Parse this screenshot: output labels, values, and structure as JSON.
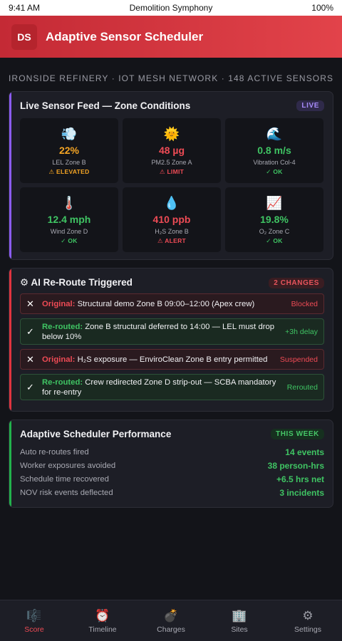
{
  "status_bar": {
    "time": "9:41 AM",
    "title": "Demolition Symphony",
    "battery": "100%"
  },
  "header": {
    "logo": "DS",
    "title": "Adaptive Sensor Scheduler"
  },
  "subtitle": "IRONSIDE REFINERY · IOT MESH NETWORK · 148 ACTIVE SENSORS",
  "sensor_feed": {
    "title": "Live Sensor Feed — Zone Conditions",
    "badge": "LIVE",
    "tiles": [
      {
        "icon": "💨",
        "icon_name": "wind-gas-icon",
        "value": "22%",
        "label": "LEL Zone B",
        "status": "⚠ ELEVATED",
        "color": "orange"
      },
      {
        "icon": "🌞",
        "icon_name": "sun-icon",
        "value": "48 µg",
        "label": "PM2.5 Zone A",
        "status": "⚠ LIMIT",
        "color": "red"
      },
      {
        "icon": "🌊",
        "icon_name": "wave-icon",
        "value": "0.8 m/s",
        "label": "Vibration Col-4",
        "status": "✓ OK",
        "color": "green"
      },
      {
        "icon": "🌡️",
        "icon_name": "thermometer-icon",
        "value": "12.4 mph",
        "label": "Wind Zone D",
        "status": "✓ OK",
        "color": "green"
      },
      {
        "icon": "💧",
        "icon_name": "droplet-icon",
        "value": "410 ppb",
        "label": "H₂S Zone B",
        "status": "⚠ ALERT",
        "color": "red"
      },
      {
        "icon": "📈",
        "icon_name": "chart-up-icon",
        "value": "19.8%",
        "label": "O₂ Zone C",
        "status": "✓ OK",
        "color": "green"
      }
    ]
  },
  "reroute": {
    "title": "⚙ AI Re-Route Triggered",
    "badge": "2 CHANGES",
    "items": [
      {
        "type": "blocked",
        "mark": "✕",
        "prefix": "Original:",
        "text": "Structural demo Zone B 09:00–12:00 (Apex crew)",
        "tag": "Blocked"
      },
      {
        "type": "ok",
        "mark": "✓",
        "prefix": "Re-routed:",
        "text": "Zone B structural deferred to 14:00 — LEL must drop below 10%",
        "tag": "+3h delay"
      },
      {
        "type": "blocked",
        "mark": "✕",
        "prefix": "Original:",
        "text": "H₂S exposure — EnviroClean Zone B entry permitted",
        "tag": "Suspended"
      },
      {
        "type": "ok",
        "mark": "✓",
        "prefix": "Re-routed:",
        "text": "Crew redirected Zone D strip-out — SCBA mandatory for re-entry",
        "tag": "Rerouted"
      }
    ]
  },
  "performance": {
    "title": "Adaptive Scheduler Performance",
    "badge": "THIS WEEK",
    "rows": [
      {
        "label": "Auto re-routes fired",
        "value": "14 events"
      },
      {
        "label": "Worker exposures avoided",
        "value": "38 person-hrs"
      },
      {
        "label": "Schedule time recovered",
        "value": "+6.5 hrs net"
      },
      {
        "label": "NOV risk events deflected",
        "value": "3 incidents"
      }
    ]
  },
  "nav": [
    {
      "icon": "🎼",
      "icon_name": "score-icon",
      "label": "Score",
      "active": true
    },
    {
      "icon": "⏰",
      "icon_name": "alarm-clock-icon",
      "label": "Timeline",
      "active": false
    },
    {
      "icon": "💣",
      "icon_name": "bomb-icon",
      "label": "Charges",
      "active": false
    },
    {
      "icon": "🏢",
      "icon_name": "building-icon",
      "label": "Sites",
      "active": false
    },
    {
      "icon": "⚙",
      "icon_name": "gear-icon",
      "label": "Settings",
      "active": false
    }
  ],
  "colors": {
    "accent": "#e0343f",
    "purple": "#8b5cf6",
    "green": "#22b24c",
    "orange": "#f5a524"
  }
}
